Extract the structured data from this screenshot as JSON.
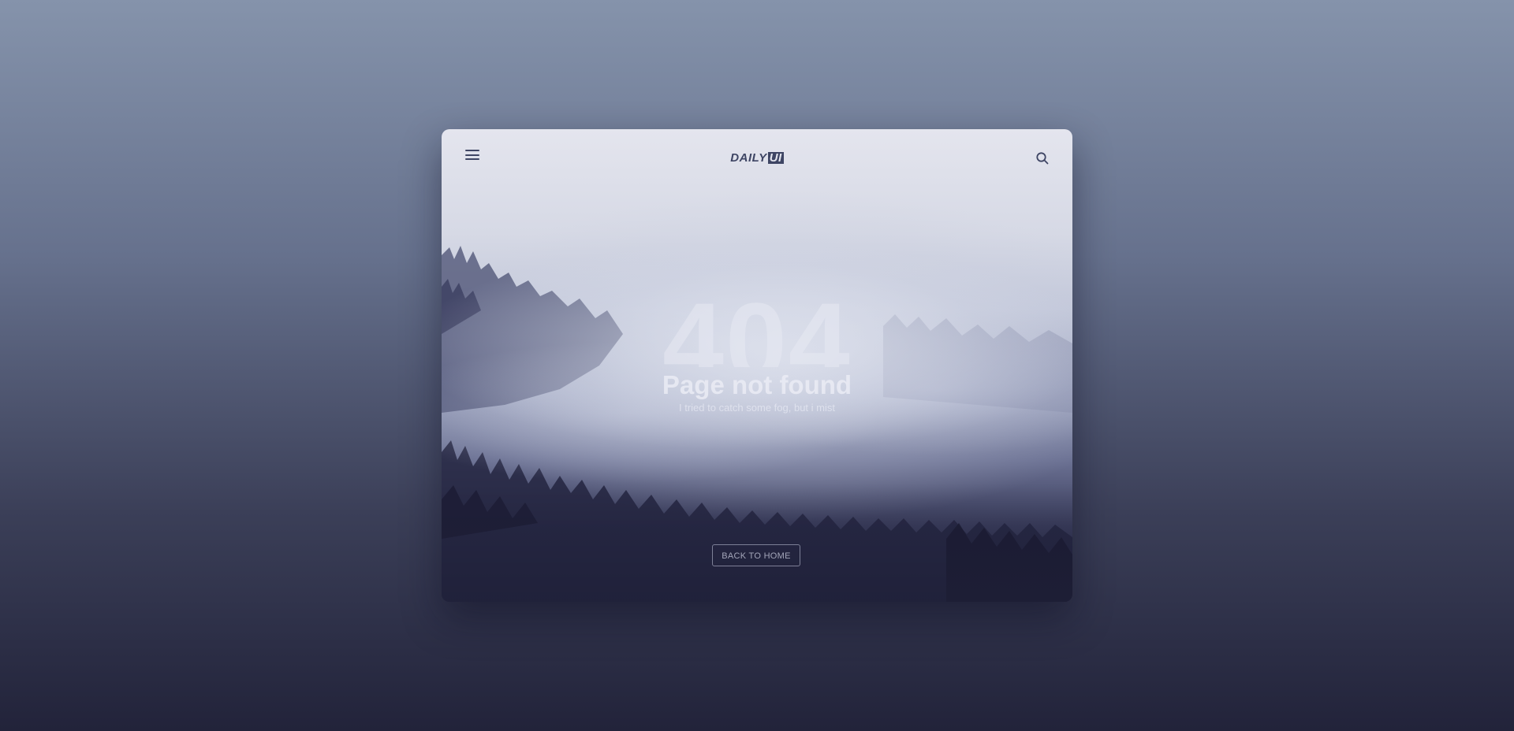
{
  "header": {
    "logo_text": "DAILY",
    "logo_badge": "UI",
    "menu_icon": "hamburger-menu-icon",
    "search_icon": "search-icon"
  },
  "main": {
    "error_code": "404",
    "headline": "Page not found",
    "subline": "I tried to catch some fog, but i mist"
  },
  "actions": {
    "back_home_label": "BACK TO HOME"
  },
  "colors": {
    "accent": "#3e4564",
    "background_top": "#8593ab",
    "background_bottom": "#22233a"
  }
}
